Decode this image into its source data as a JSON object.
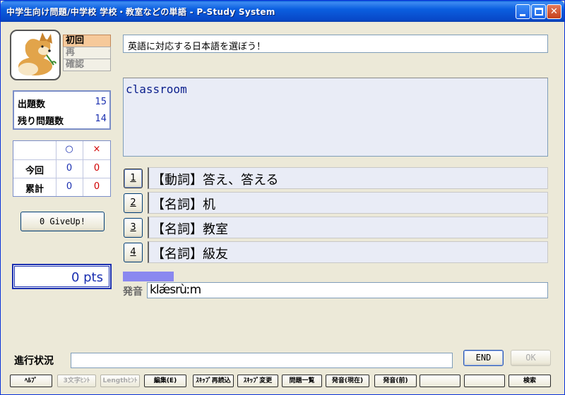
{
  "window": {
    "title": "中学生向け問題/中学校 学校・教室などの単語 - P-Study System"
  },
  "stages": [
    "初回",
    "再",
    "確認"
  ],
  "counts": [
    {
      "label": "出題数",
      "value": "15"
    },
    {
      "label": "残り問題数",
      "value": "14"
    }
  ],
  "score": {
    "correct_mark": "○",
    "wrong_mark": "×",
    "rows": [
      {
        "label": "今回",
        "correct": "0",
        "wrong": "0"
      },
      {
        "label": "累計",
        "correct": "0",
        "wrong": "0"
      }
    ]
  },
  "giveup_label": "0 GiveUp!",
  "points": "0 pts",
  "instruction": "英語に対応する日本語を選ぼう！",
  "question": "classroom",
  "choices": [
    {
      "num": "1",
      "text": "【動詞】答え、答える"
    },
    {
      "num": "2",
      "text": "【名詞】机"
    },
    {
      "num": "3",
      "text": "【名詞】教室"
    },
    {
      "num": "4",
      "text": "【名詞】級友"
    }
  ],
  "time_remaining": 0.12,
  "pronunciation_label": "発音",
  "pronunciation": "klǽsrùːm",
  "progress_label": "進行状況",
  "end_label": "END",
  "ok_label": "OK",
  "bottom_buttons": [
    {
      "label": "ﾍﾙﾌﾟ",
      "enabled": true
    },
    {
      "label": "3文字ﾋﾝﾄ",
      "enabled": false
    },
    {
      "label": "Lengthﾋﾝﾄ",
      "enabled": false
    },
    {
      "label": "編集(E)",
      "enabled": true
    },
    {
      "label": "ｽｷｯﾌﾟ再読込",
      "enabled": true
    },
    {
      "label": "ｽｷｯﾌﾟ変更",
      "enabled": true
    },
    {
      "label": "問題一覧",
      "enabled": true
    },
    {
      "label": "発音(現在)",
      "enabled": true
    },
    {
      "label": "発音(前)",
      "enabled": true
    },
    {
      "label": "",
      "enabled": true
    },
    {
      "label": "",
      "enabled": true
    },
    {
      "label": "検索",
      "enabled": true
    }
  ]
}
